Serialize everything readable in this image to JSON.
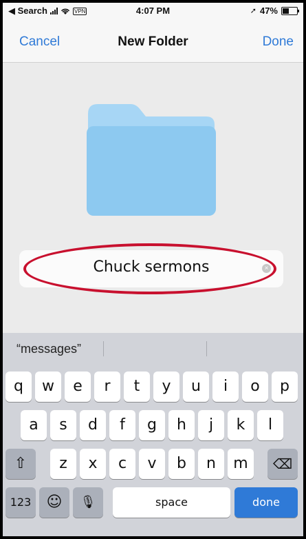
{
  "status_bar": {
    "back_label": "◀ Search",
    "vpn_label": "VPN",
    "time": "4:07 PM",
    "battery_text": "47%",
    "location_glyph": "➚"
  },
  "nav": {
    "cancel_label": "Cancel",
    "title": "New Folder",
    "done_label": "Done"
  },
  "folder": {
    "icon": "folder-icon",
    "name_value": "Chuck sermons",
    "clear_glyph": "×"
  },
  "keyboard": {
    "suggestions": [
      "“messages”",
      "",
      ""
    ],
    "row1": [
      "q",
      "w",
      "e",
      "r",
      "t",
      "y",
      "u",
      "i",
      "o",
      "p"
    ],
    "row2": [
      "a",
      "s",
      "d",
      "f",
      "g",
      "h",
      "j",
      "k",
      "l"
    ],
    "row3": [
      "z",
      "x",
      "c",
      "v",
      "b",
      "n",
      "m"
    ],
    "shift_glyph": "⇧",
    "delete_glyph": "⌫",
    "numbers_label": "123",
    "emoji_glyph": "☺",
    "mic_glyph": "🎙",
    "space_label": "space",
    "done_label": "done"
  },
  "colors": {
    "accent": "#2f7ad7",
    "folder_light": "#a7d6f5",
    "folder_main": "#8dc9f0",
    "annotation_red": "#c8102e",
    "keyboard_bg": "#d1d3d9"
  }
}
